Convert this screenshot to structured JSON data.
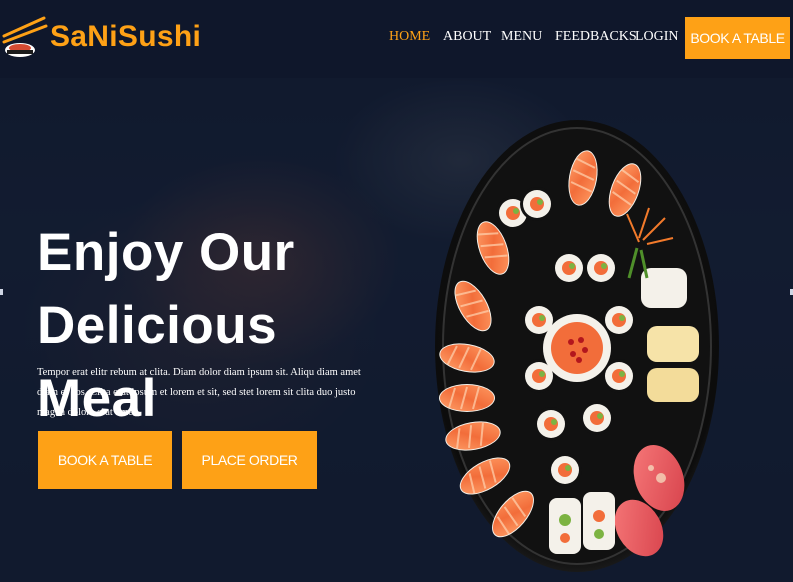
{
  "brand": {
    "name": "SaNiSushi",
    "icon": "chopsticks-sushi-icon"
  },
  "nav": {
    "items": [
      {
        "label": "HOME",
        "active": true
      },
      {
        "label": "ABOUT",
        "active": false
      },
      {
        "label": "MENU",
        "active": false
      },
      {
        "label": "FEEDBACKS",
        "active": false
      },
      {
        "label": "LOGIN",
        "active": false
      }
    ],
    "cta_label": "BOOK A TABLE"
  },
  "hero": {
    "title_line1": "Enjoy Our",
    "title_line2": "Delicious Meal",
    "description": "Tempor erat elitr rebum at clita. Diam dolor diam ipsum sit. Aliqu diam amet diam et eos. Clita erat ipsum et lorem et sit, sed stet lorem sit clita duo justo magna dolore erat amet",
    "button_primary": "BOOK A TABLE",
    "button_secondary": "PLACE ORDER",
    "image": "sushi-platter-image"
  },
  "colors": {
    "accent": "#fea116",
    "dark": "#0f172b",
    "text": "#ffffff"
  }
}
